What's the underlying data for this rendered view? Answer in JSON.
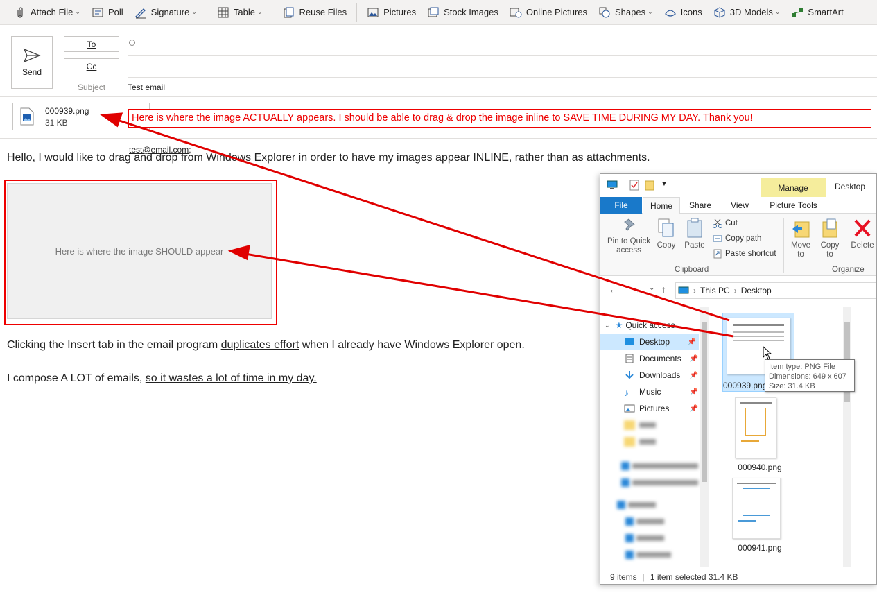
{
  "ribbon": {
    "items": [
      {
        "label": "Attach File",
        "icon": "paperclip-icon",
        "dropdown": true
      },
      {
        "label": "Poll",
        "icon": "poll-icon",
        "dropdown": false
      },
      {
        "label": "Signature",
        "icon": "signature-icon",
        "dropdown": true
      },
      {
        "label": "Table",
        "icon": "table-icon",
        "dropdown": true
      },
      {
        "label": "Reuse Files",
        "icon": "reuse-files-icon",
        "dropdown": false
      },
      {
        "label": "Pictures",
        "icon": "pictures-icon",
        "dropdown": false
      },
      {
        "label": "Stock Images",
        "icon": "stock-images-icon",
        "dropdown": false
      },
      {
        "label": "Online Pictures",
        "icon": "online-pictures-icon",
        "dropdown": false
      },
      {
        "label": "Shapes",
        "icon": "shapes-icon",
        "dropdown": true
      },
      {
        "label": "Icons",
        "icon": "icons-icon",
        "dropdown": false
      },
      {
        "label": "3D Models",
        "icon": "3d-models-icon",
        "dropdown": true
      },
      {
        "label": "SmartArt",
        "icon": "smartart-icon",
        "dropdown": false
      }
    ]
  },
  "compose": {
    "send_label": "Send",
    "to_label": "To",
    "cc_label": "Cc",
    "subject_label": "Subject",
    "to_value": "test@email.com;",
    "subject_value": "Test email"
  },
  "attachment": {
    "name": "000939.png",
    "size": "31 KB"
  },
  "annotations": {
    "actual_note": "Here is where the image ACTUALLY appears. I should be able to drag & drop the image inline to SAVE TIME DURING MY DAY. Thank you!",
    "placeholder": "Here is where the image SHOULD appear",
    "arrow_color": "#e00000"
  },
  "body": {
    "para1": "Hello, I would like to drag and drop from Windows Explorer in order to have my images appear INLINE, rather than as attachments.",
    "para2_before": "Clicking the Insert tab in the email program ",
    "para2_link": "duplicates effort",
    "para2_after": " when I already have Windows Explorer open.",
    "para3_before": "I compose A LOT of emails, ",
    "para3_link": "so it wastes a lot of time in my day."
  },
  "explorer": {
    "title": "Desktop",
    "manage": "Manage",
    "tabs": {
      "file": "File",
      "home": "Home",
      "share": "Share",
      "view": "View",
      "picture_tools": "Picture Tools"
    },
    "ribbon": {
      "pin": "Pin to Quick access",
      "copy": "Copy",
      "paste": "Paste",
      "cut": "Cut",
      "copy_path": "Copy path",
      "paste_shortcut": "Paste shortcut",
      "clipboard": "Clipboard",
      "move_to": "Move to",
      "copy_to": "Copy to",
      "delete": "Delete",
      "organize": "Organize"
    },
    "address": {
      "this_pc": "This PC",
      "desktop": "Desktop"
    },
    "nav": {
      "quick_access": "Quick access",
      "desktop": "Desktop",
      "documents": "Documents",
      "downloads": "Downloads",
      "music": "Music",
      "pictures": "Pictures"
    },
    "files": [
      "000939.png",
      "000940.png",
      "000941.png"
    ],
    "tooltip": {
      "type": "Item type: PNG File",
      "dimensions": "Dimensions: 649 x 607",
      "size": "Size: 31.4 KB"
    },
    "status": {
      "items": "9 items",
      "selected": "1 item selected  31.4 KB"
    }
  }
}
